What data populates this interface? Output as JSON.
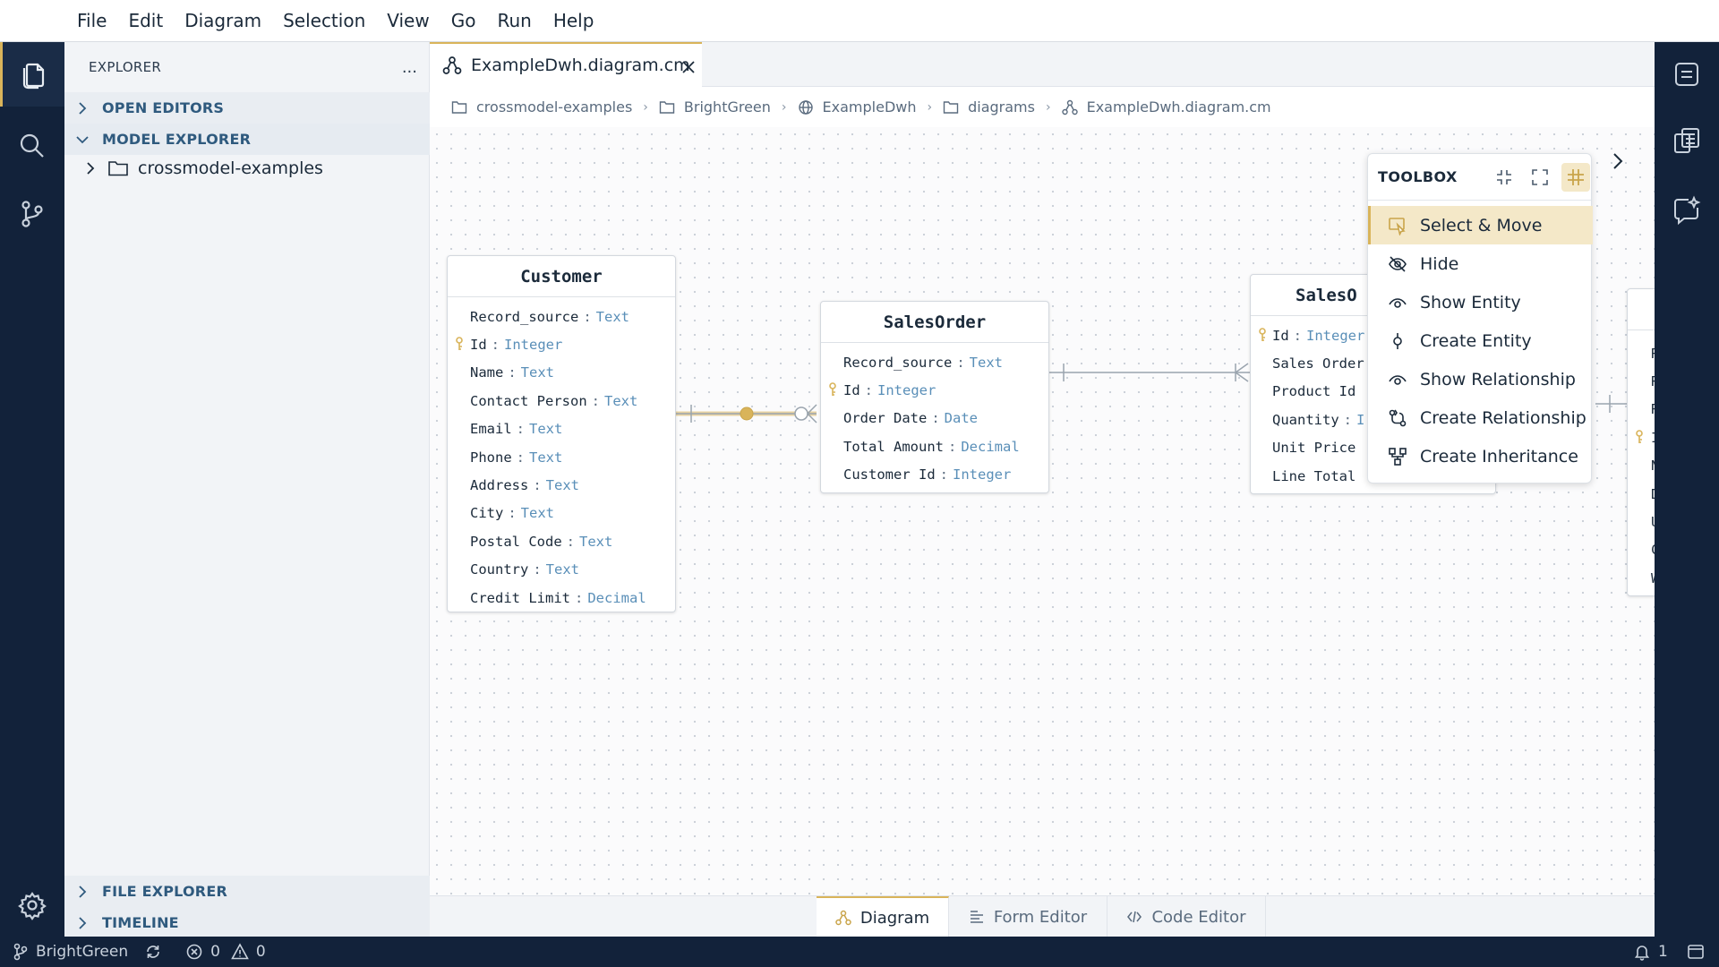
{
  "menu": [
    "File",
    "Edit",
    "Diagram",
    "Selection",
    "View",
    "Go",
    "Run",
    "Help"
  ],
  "sidebar": {
    "title": "EXPLORER",
    "more": "...",
    "sections": {
      "open_editors": "OPEN EDITORS",
      "model_explorer": "MODEL EXPLORER",
      "file_explorer": "FILE EXPLORER",
      "timeline": "TIMELINE"
    },
    "tree_root": "crossmodel-examples"
  },
  "editor": {
    "tab_label": "ExampleDwh.diagram.cm",
    "breadcrumb": [
      "crossmodel-examples",
      "BrightGreen",
      "ExampleDwh",
      "diagrams",
      "ExampleDwh.diagram.cm"
    ]
  },
  "entities": {
    "customer": {
      "title": "Customer",
      "attrs": [
        {
          "name": "Record_source",
          "type": "Text"
        },
        {
          "name": "Id",
          "type": "Integer"
        },
        {
          "name": "Name",
          "type": "Text"
        },
        {
          "name": "Contact Person",
          "type": "Text"
        },
        {
          "name": "Email",
          "type": "Text"
        },
        {
          "name": "Phone",
          "type": "Text"
        },
        {
          "name": "Address",
          "type": "Text"
        },
        {
          "name": "City",
          "type": "Text"
        },
        {
          "name": "Postal Code",
          "type": "Text"
        },
        {
          "name": "Country",
          "type": "Text"
        },
        {
          "name": "Credit Limit",
          "type": "Decimal"
        }
      ]
    },
    "salesorder": {
      "title": "SalesOrder",
      "attrs": [
        {
          "name": "Record_source",
          "type": "Text"
        },
        {
          "name": "Id",
          "type": "Integer"
        },
        {
          "name": "Order Date",
          "type": "Date"
        },
        {
          "name": "Total Amount",
          "type": "Decimal"
        },
        {
          "name": "Customer Id",
          "type": "Integer"
        }
      ]
    },
    "salesorderitem": {
      "title": "SalesO",
      "attrs": [
        {
          "name": "Id",
          "type": "Integer"
        },
        {
          "name": "Sales Order",
          "type": ""
        },
        {
          "name": "Product Id",
          "type": ""
        },
        {
          "name": "Quantity",
          "type": "I"
        },
        {
          "name": "Unit Price",
          "type": ""
        },
        {
          "name": "Line Total",
          "type": ""
        }
      ]
    },
    "partial_right_letters": [
      "R",
      "R",
      "R",
      "I",
      "N",
      "D",
      "U",
      "C",
      "W"
    ]
  },
  "attr_separator": ":",
  "toolbox": {
    "title": "TOOLBOX",
    "items": [
      "Select & Move",
      "Hide",
      "Show Entity",
      "Create Entity",
      "Show Relationship",
      "Create Relationship",
      "Create Inheritance"
    ]
  },
  "bottom_tabs": [
    "Diagram",
    "Form Editor",
    "Code Editor"
  ],
  "status": {
    "branch": "BrightGreen",
    "errors": "0",
    "warnings": "0",
    "notifications": "1"
  },
  "colors": {
    "accent": "#d9b45a",
    "activity_bg": "#12223a",
    "type_blue": "#5a8fb8",
    "selection_bg": "#f4e8c8"
  }
}
